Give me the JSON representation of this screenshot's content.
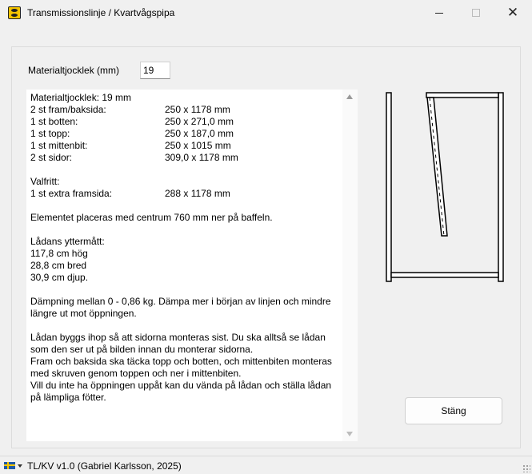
{
  "window": {
    "title": "Transmissionslinje / Kvartvågspipa",
    "minimize": "–",
    "maximize": "☐",
    "close": "✕"
  },
  "thickness": {
    "label": "Materialtjocklek (mm)",
    "value": "19"
  },
  "output": {
    "parts": [
      {
        "name": "Materialtjocklek: 19 mm",
        "size": ""
      },
      {
        "name": "2 st fram/baksida:",
        "size": "250 x 1178 mm"
      },
      {
        "name": "1 st botten:",
        "size": "250 x 271,0 mm"
      },
      {
        "name": "1 st topp:",
        "size": "250 x 187,0 mm"
      },
      {
        "name": "1 st mittenbit:",
        "size": "250 x 1015 mm"
      },
      {
        "name": "2 st sidor:",
        "size": "309,0 x 1178 mm"
      }
    ],
    "optional_heading": "Valfritt:",
    "optional": [
      {
        "name": "1 st extra framsida:",
        "size": "288 x 1178 mm"
      }
    ],
    "placement": "Elementet placeras med centrum 760 mm ner på baffeln.",
    "dimensions_heading": "Lådans yttermått:",
    "dimensions": [
      "117,8 cm hög",
      "28,8 cm bred",
      "30,9 cm djup."
    ],
    "damping": "Dämpning mellan 0 - 0,86 kg. Dämpa mer i början av linjen och mindre längre ut mot öppningen.",
    "assembly": [
      "Lådan byggs ihop så att sidorna monteras sist. Du ska alltså se lådan som den ser ut på bilden innan du monterar sidorna.",
      "Fram och baksida ska täcka topp och botten, och mittenbiten monteras med skruven genom toppen och ner i mittenbiten.",
      "Vill du inte ha öppningen uppåt kan du vända på lådan och ställa lådan på lämpliga fötter."
    ]
  },
  "buttons": {
    "close_label": "Stäng"
  },
  "status": {
    "language_icon": "swedish-flag-icon",
    "text": "TL/KV v1.0  (Gabriel Karlsson, 2025)"
  },
  "colors": {
    "window_bg": "#f0f0f0",
    "text_bg": "#ffffff",
    "flag_blue": "#1f5aa6",
    "flag_yellow": "#f6c700",
    "icon_yellow": "#f5c400"
  }
}
